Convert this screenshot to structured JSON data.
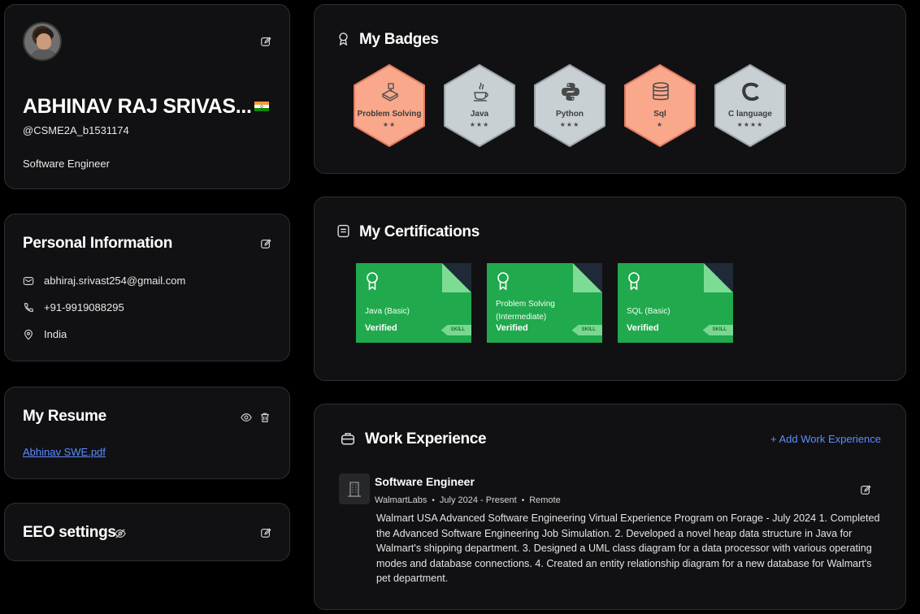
{
  "profile": {
    "name": "ABHINAV RAJ SRIVAS...",
    "handle": "@CSME2A_b1531174",
    "role": "Software Engineer"
  },
  "personal_info": {
    "title": "Personal Information",
    "email": "abhiraj.srivast254@gmail.com",
    "phone": "+91-9919088295",
    "location": "India"
  },
  "resume": {
    "title": "My Resume",
    "file": "Abhinav SWE.pdf"
  },
  "eeo": {
    "title": "EEO settings"
  },
  "badges": {
    "title": "My Badges",
    "items": [
      {
        "label": "Problem Solving",
        "stars": "★★",
        "color": "#f9a88c",
        "icon": "problem-solving-icon"
      },
      {
        "label": "Java",
        "stars": "★★★",
        "color": "#c8d0d4",
        "icon": "java-icon"
      },
      {
        "label": "Python",
        "stars": "★★★",
        "color": "#c8d0d4",
        "icon": "python-icon"
      },
      {
        "label": "Sql",
        "stars": "★",
        "color": "#f9a88c",
        "icon": "database-icon"
      },
      {
        "label": "C language",
        "stars": "★★★★",
        "color": "#c8d0d4",
        "icon": "c-language-icon"
      }
    ]
  },
  "certifications": {
    "title": "My Certifications",
    "items": [
      {
        "name": "Java (Basic)",
        "status": "Verified",
        "tag": "SKILL"
      },
      {
        "name": "Problem Solving (Intermediate)",
        "status": "Verified",
        "tag": "SKILL"
      },
      {
        "name": "SQL (Basic)",
        "status": "Verified",
        "tag": "SKILL"
      }
    ]
  },
  "work": {
    "title": "Work Experience",
    "add_label": "+ Add Work Experience",
    "jobs": [
      {
        "title": "Software Engineer",
        "company": "WalmartLabs",
        "period": "July 2024 - Present",
        "mode": "Remote",
        "description": "Walmart USA Advanced Software Engineering Virtual Experience Program on Forage - July 2024 1. Completed the Advanced Software Engineering Job Simulation. 2. Developed a novel heap data structure in Java for Walmart's shipping department. 3. Designed a UML class diagram for a data processor with various operating modes and database connections. 4. Created an entity relationship diagram for a new database for Walmart's pet department."
      }
    ]
  },
  "colors": {
    "background": "#000000",
    "card": "#111113",
    "link": "#5b8dff",
    "cert_green": "#21a94d"
  }
}
